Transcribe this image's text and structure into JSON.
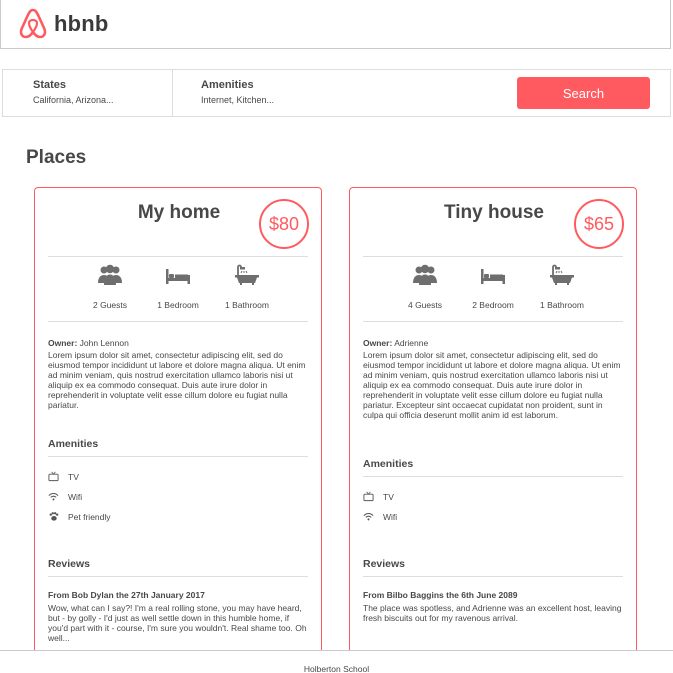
{
  "header": {
    "logo_text": "hbnb"
  },
  "filters": {
    "states": {
      "title": "States",
      "value": "California, Arizona..."
    },
    "amenities": {
      "title": "Amenities",
      "value": "Internet, Kitchen..."
    },
    "search_label": "Search"
  },
  "places_title": "Places",
  "places": [
    {
      "name": "My home",
      "price": "$80",
      "guests": "2 Guests",
      "bedrooms": "1 Bedroom",
      "bathrooms": "1 Bathroom",
      "owner_label": "Owner:",
      "owner": "John Lennon",
      "description": "Lorem ipsum dolor sit amet, consectetur adipiscing elit, sed do eiusmod tempor incididunt ut labore et dolore magna aliqua. Ut enim ad minim veniam, quis nostrud exercitation ullamco laboris nisi ut aliquip ex ea commodo consequat. Duis aute irure dolor in reprehenderit in voluptate velit esse cillum dolore eu fugiat nulla pariatur.",
      "amenities_title": "Amenities",
      "amenities": [
        {
          "icon": "tv-icon",
          "label": "TV"
        },
        {
          "icon": "wifi-icon",
          "label": "Wifi"
        },
        {
          "icon": "paw-icon",
          "label": "Pet friendly"
        }
      ],
      "reviews_title": "Reviews",
      "review": {
        "from": "From Bob Dylan the 27th January 2017",
        "text": "Wow, what can I say?! I'm a real rolling stone, you may have heard, but - by golly - I'd just as well settle down in this humble home, if you'd part with it - course, I'm sure you wouldn't. Real shame too. Oh well..."
      }
    },
    {
      "name": "Tiny house",
      "price": "$65",
      "guests": "4 Guests",
      "bedrooms": "2 Bedroom",
      "bathrooms": "1 Bathroom",
      "owner_label": "Owner:",
      "owner": "Adrienne",
      "description": "Lorem ipsum dolor sit amet, consectetur adipiscing elit, sed do eiusmod tempor incididunt ut labore et dolore magna aliqua. Ut enim ad minim veniam, quis nostrud exercitation ullamco laboris nisi ut aliquip ex ea commodo consequat. Duis aute irure dolor in reprehenderit in voluptate velit esse cillum dolore eu fugiat nulla pariatur. Excepteur sint occaecat cupidatat non proident, sunt in culpa qui officia deserunt mollit anim id est laborum.",
      "amenities_title": "Amenities",
      "amenities": [
        {
          "icon": "tv-icon",
          "label": "TV"
        },
        {
          "icon": "wifi-icon",
          "label": "Wifi"
        }
      ],
      "reviews_title": "Reviews",
      "review": {
        "from": "From Bilbo Baggins the 6th June 2089",
        "text": "The place was spotless, and Adrienne was an excellent host, leaving fresh biscuits out for my ravenous arrival."
      }
    }
  ],
  "footer": {
    "text": "Holberton School"
  },
  "colors": {
    "accent": "#ff5a5f",
    "text": "#484848",
    "border": "#dddddd"
  }
}
